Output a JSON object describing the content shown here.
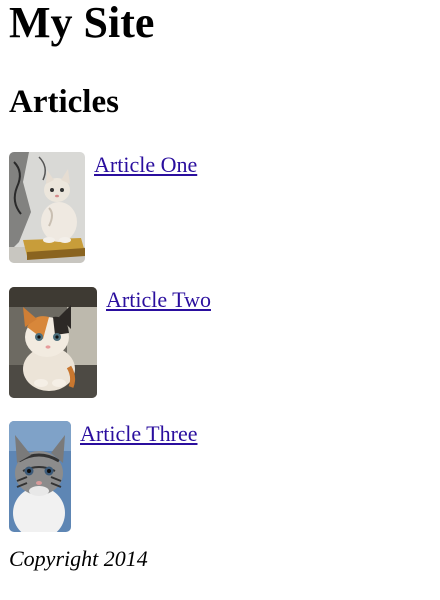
{
  "header": {
    "site_title": "My Site"
  },
  "main": {
    "section_heading": "Articles",
    "articles": [
      {
        "title": "Article One",
        "thumbnail": "kitten-photo"
      },
      {
        "title": "Article Two",
        "thumbnail": "kitten-photo"
      },
      {
        "title": "Article Three",
        "thumbnail": "kitten-photo"
      }
    ]
  },
  "footer": {
    "copyright": "Copyright 2014"
  },
  "colors": {
    "link": "#2a0e9e",
    "text": "#000000",
    "background": "#ffffff"
  }
}
